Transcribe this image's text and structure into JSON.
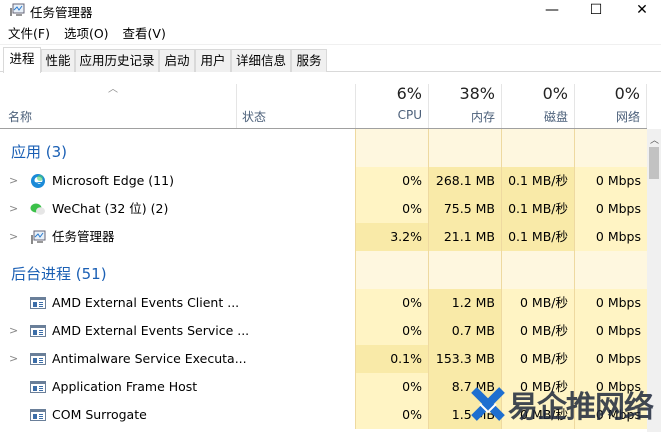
{
  "window": {
    "title": "任务管理器",
    "minimize": "—",
    "maximize": "☐",
    "close": "✕"
  },
  "menu": [
    "文件(F)",
    "选项(O)",
    "查看(V)"
  ],
  "tabs": [
    {
      "label": "进程",
      "active": true
    },
    {
      "label": "性能"
    },
    {
      "label": "应用历史记录"
    },
    {
      "label": "启动"
    },
    {
      "label": "用户"
    },
    {
      "label": "详细信息"
    },
    {
      "label": "服务"
    }
  ],
  "header": {
    "name": "名称",
    "status": "状态",
    "sort_icon": "chevron-up-icon",
    "columns": [
      {
        "pct": "6%",
        "label": "CPU"
      },
      {
        "pct": "38%",
        "label": "内存"
      },
      {
        "pct": "0%",
        "label": "磁盘"
      },
      {
        "pct": "0%",
        "label": "网络"
      }
    ]
  },
  "groups": [
    {
      "title": "应用 (3)",
      "rows": [
        {
          "name": "Microsoft Edge (11)",
          "icon": "edge-icon",
          "expand": true,
          "cpu": "0%",
          "mem": "268.1 MB",
          "disk": "0.1 MB/秒",
          "net": "0 Mbps",
          "heat": [
            0,
            1,
            1,
            0
          ]
        },
        {
          "name": "WeChat (32 位) (2)",
          "icon": "wechat-icon",
          "expand": true,
          "cpu": "0%",
          "mem": "75.5 MB",
          "disk": "0.1 MB/秒",
          "net": "0 Mbps",
          "heat": [
            0,
            1,
            1,
            0
          ]
        },
        {
          "name": "任务管理器",
          "icon": "task-manager-icon",
          "expand": true,
          "cpu": "3.2%",
          "mem": "21.1 MB",
          "disk": "0.1 MB/秒",
          "net": "0 Mbps",
          "heat": [
            1,
            1,
            1,
            0
          ]
        }
      ]
    },
    {
      "title": "后台进程 (51)",
      "rows": [
        {
          "name": "AMD External Events Client ...",
          "icon": "process-icon",
          "expand": false,
          "cpu": "0%",
          "mem": "1.2 MB",
          "disk": "0 MB/秒",
          "net": "0 Mbps",
          "heat": [
            0,
            1,
            0,
            0
          ]
        },
        {
          "name": "AMD External Events Service ...",
          "icon": "process-icon",
          "expand": true,
          "cpu": "0%",
          "mem": "0.7 MB",
          "disk": "0 MB/秒",
          "net": "0 Mbps",
          "heat": [
            0,
            1,
            0,
            0
          ]
        },
        {
          "name": "Antimalware Service Executa...",
          "icon": "process-icon",
          "expand": true,
          "cpu": "0.1%",
          "mem": "153.3 MB",
          "disk": "0 MB/秒",
          "net": "0 Mbps",
          "heat": [
            1,
            1,
            0,
            0
          ]
        },
        {
          "name": "Application Frame Host",
          "icon": "process-icon",
          "expand": false,
          "cpu": "0%",
          "mem": "8.7 MB",
          "disk": "0 MB/秒",
          "net": "0 Mbps",
          "heat": [
            0,
            1,
            0,
            0
          ]
        },
        {
          "name": "COM Surrogate",
          "icon": "process-icon",
          "expand": false,
          "cpu": "0%",
          "mem": "1.5 MB",
          "disk": "0 MB/秒",
          "net": "0 Mbps",
          "heat": [
            0,
            1,
            0,
            0
          ]
        }
      ]
    }
  ],
  "colors": {
    "heat_light": "#fff4c4",
    "heat_mid": "#f9eaa8",
    "group_title": "#1a5fb4"
  },
  "watermark": "易企推网络"
}
